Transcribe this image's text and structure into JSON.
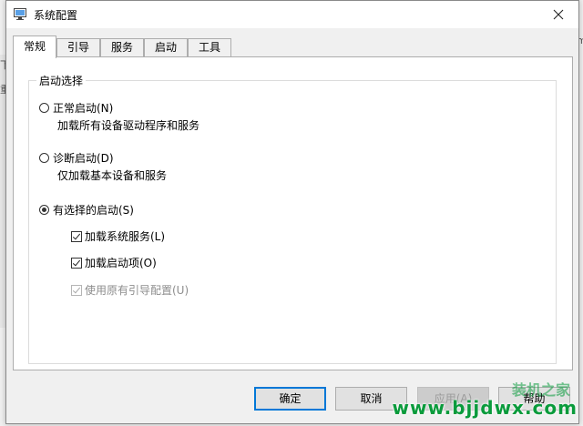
{
  "background": {
    "left_chars": [
      "下",
      "重"
    ],
    "right_char": "m"
  },
  "window": {
    "title": "系统配置",
    "app_icon": "msconfig-icon"
  },
  "tabs": [
    {
      "label": "常规",
      "active": true
    },
    {
      "label": "引导",
      "active": false
    },
    {
      "label": "服务",
      "active": false
    },
    {
      "label": "启动",
      "active": false
    },
    {
      "label": "工具",
      "active": false
    }
  ],
  "startup_selection": {
    "group_label": "启动选择",
    "normal": {
      "label": "正常启动(N)",
      "description": "加载所有设备驱动程序和服务",
      "checked": false
    },
    "diagnostic": {
      "label": "诊断启动(D)",
      "description": "仅加载基本设备和服务",
      "checked": false
    },
    "selective": {
      "label": "有选择的启动(S)",
      "checked": true,
      "options": [
        {
          "label": "加载系统服务(L)",
          "checked": true,
          "enabled": true
        },
        {
          "label": "加载启动项(O)",
          "checked": true,
          "enabled": true
        },
        {
          "label": "使用原有引导配置(U)",
          "checked": true,
          "enabled": false
        }
      ]
    }
  },
  "buttons": {
    "ok": "确定",
    "cancel": "取消",
    "apply": "应用(A)",
    "help": "帮助"
  },
  "watermark": {
    "url": "www.bjjdwx.com",
    "text": "装机之家"
  },
  "colors": {
    "accent": "#0078d7",
    "watermark": "#0a9b3c"
  }
}
